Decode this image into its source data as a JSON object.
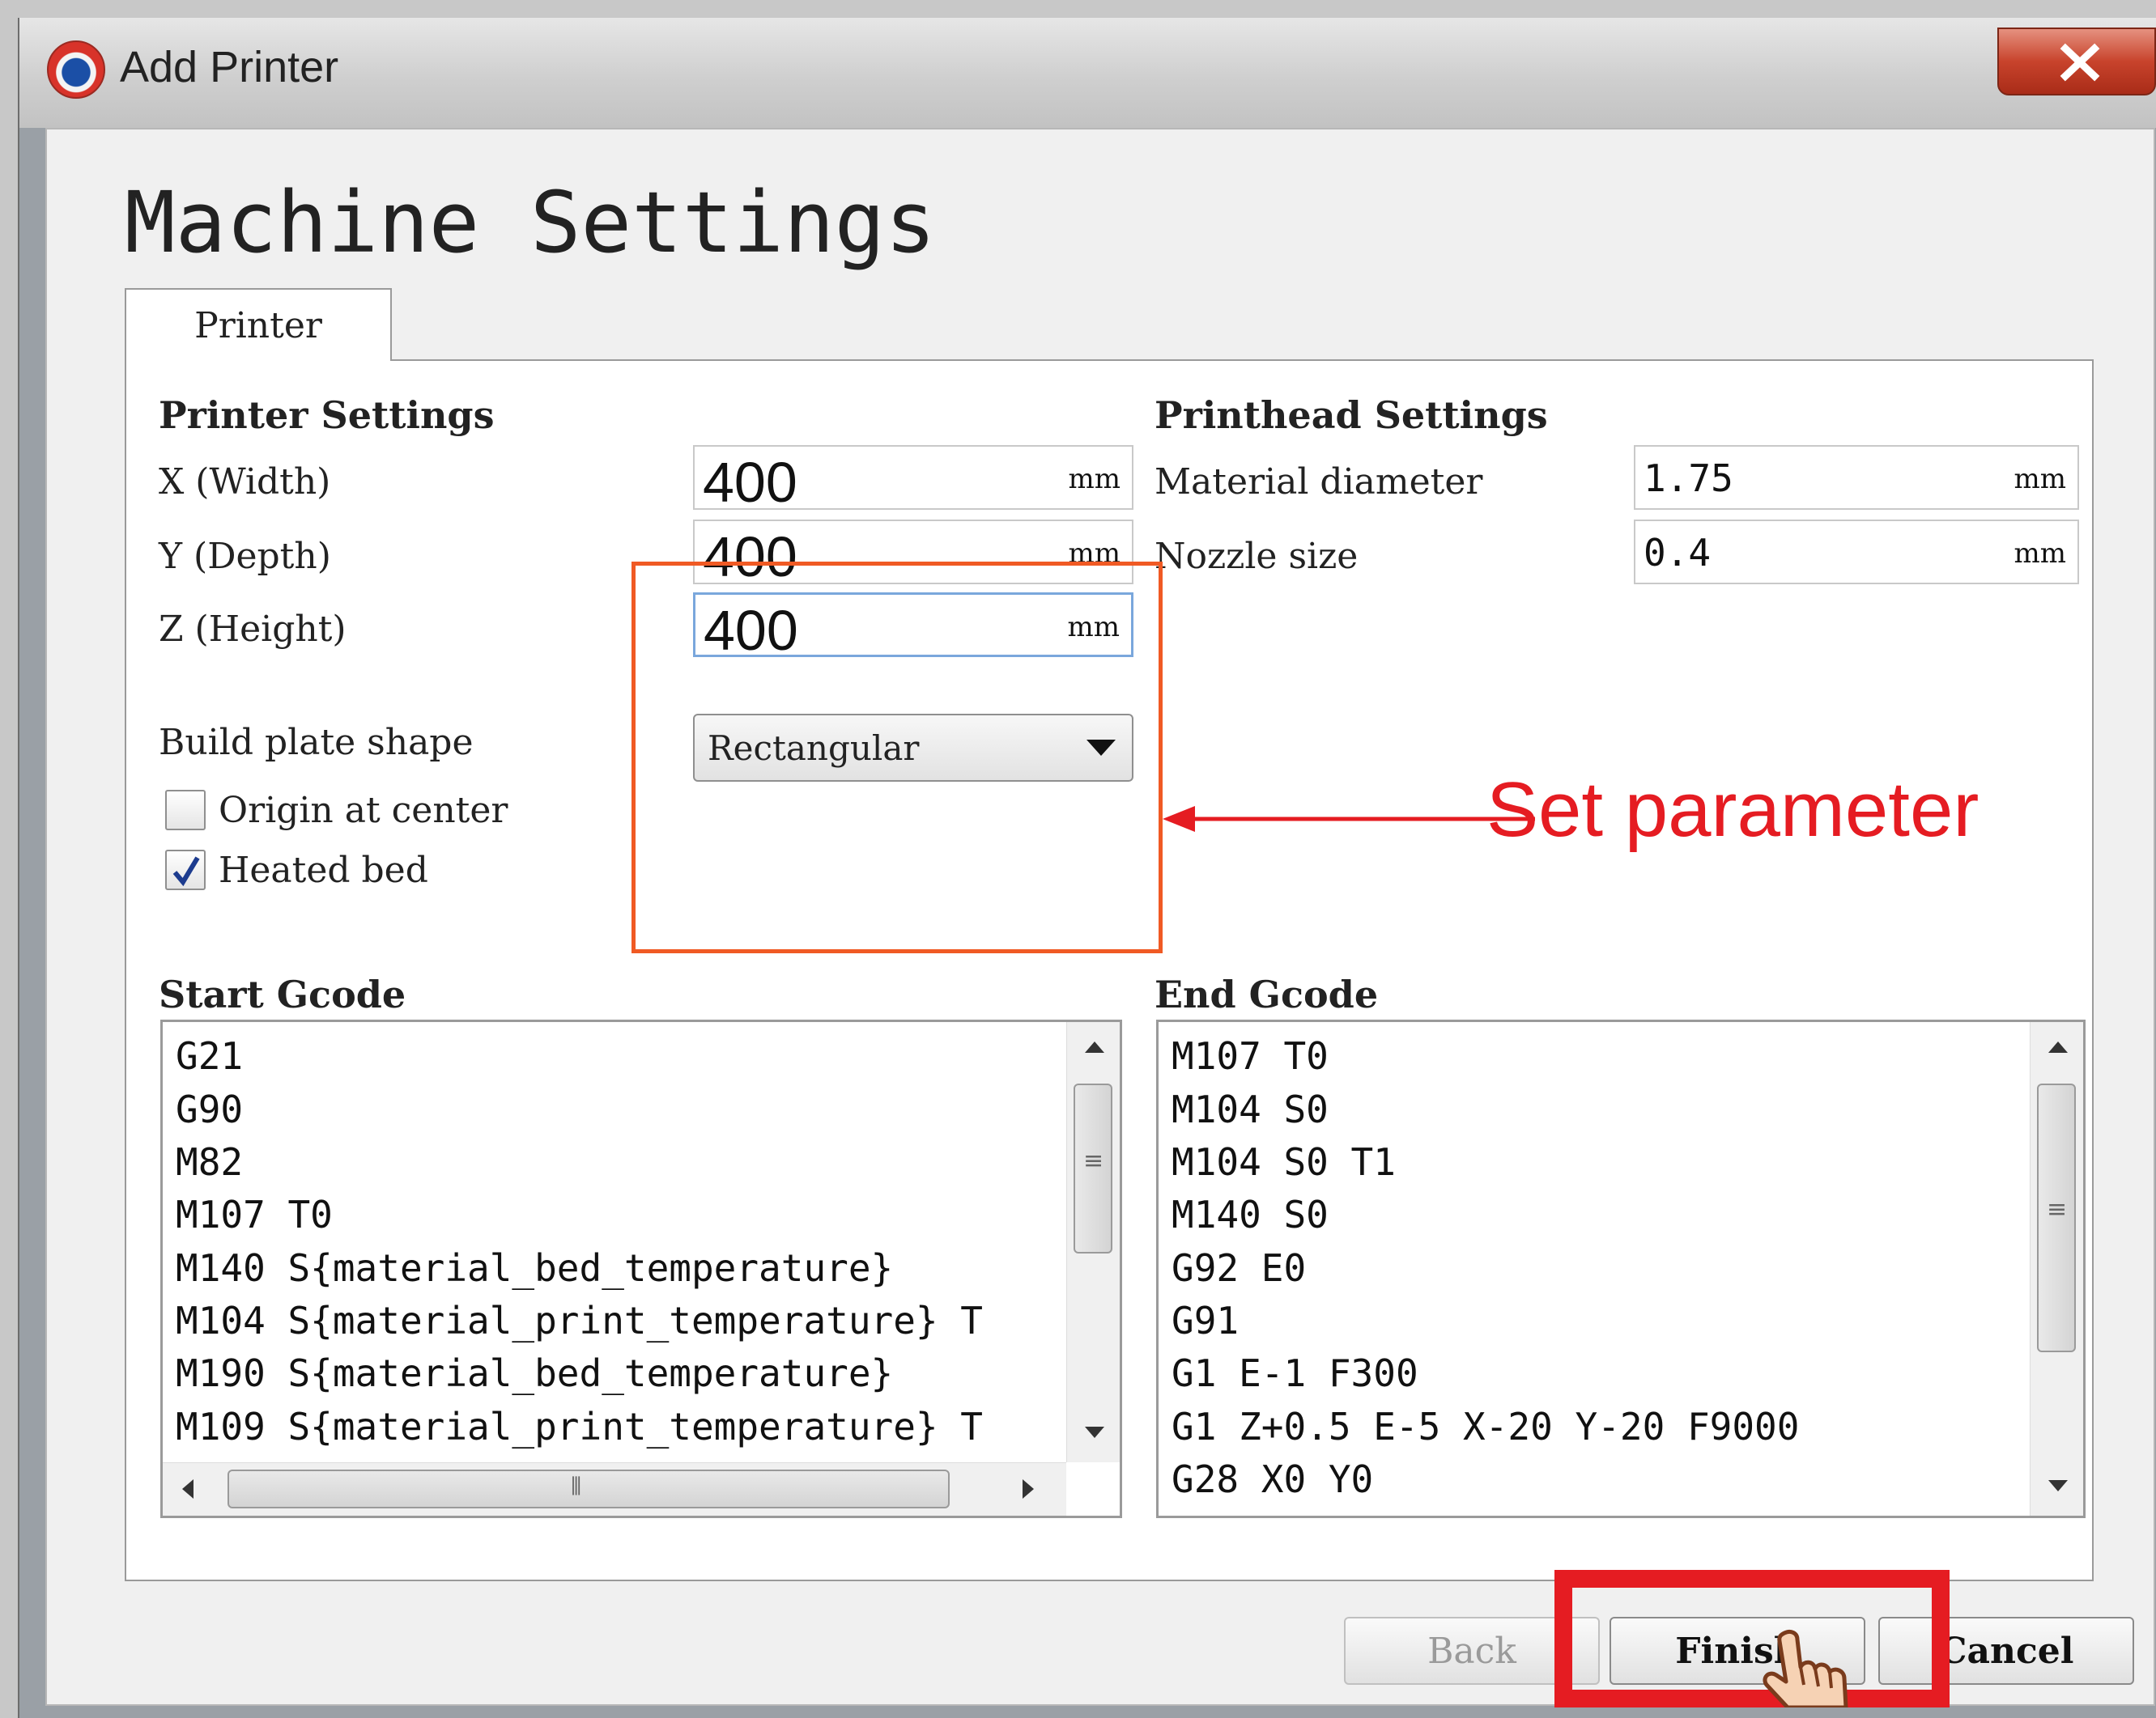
{
  "window": {
    "title": "Add Printer"
  },
  "page": {
    "heading": "Machine Settings"
  },
  "tabs": [
    {
      "label": "Printer"
    }
  ],
  "printer_settings": {
    "title": "Printer Settings",
    "x": {
      "label": "X (Width)",
      "value": "400",
      "unit": "mm"
    },
    "y": {
      "label": "Y (Depth)",
      "value": "400",
      "unit": "mm"
    },
    "z": {
      "label": "Z (Height)",
      "value": "400",
      "unit": "mm"
    },
    "build_plate": {
      "label": "Build plate shape",
      "value": "Rectangular"
    },
    "origin_center": {
      "label": "Origin at center",
      "checked": false
    },
    "heated_bed": {
      "label": "Heated bed",
      "checked": true
    }
  },
  "printhead_settings": {
    "title": "Printhead Settings",
    "material_diameter": {
      "label": "Material diameter",
      "value": "1.75",
      "unit": "mm"
    },
    "nozzle_size": {
      "label": "Nozzle size",
      "value": "0.4",
      "unit": "mm"
    }
  },
  "start_gcode": {
    "title": "Start Gcode",
    "lines": [
      "G21",
      "G90",
      "M82",
      "M107 T0",
      "M140 S{material_bed_temperature}",
      "M104 S{material_print_temperature} T",
      "M190 S{material_bed_temperature}",
      "M109 S{material_print_temperature} T"
    ]
  },
  "end_gcode": {
    "title": "End Gcode",
    "lines": [
      "M107 T0",
      "M104 S0",
      "M104 S0 T1",
      "M140 S0",
      "G92 E0",
      "G91",
      "G1 E-1 F300",
      "G1 Z+0.5 E-5 X-20 Y-20 F9000",
      "G28 X0 Y0"
    ]
  },
  "buttons": {
    "back": "Back",
    "finish": "Finish",
    "cancel": "Cancel"
  },
  "annotation": {
    "text": "Set parameter",
    "color": "#e51c22",
    "box_color": "#f05a24"
  },
  "icons": {
    "app": "cura-app-icon",
    "close": "close-icon",
    "cursor": "hand-pointer-icon"
  }
}
